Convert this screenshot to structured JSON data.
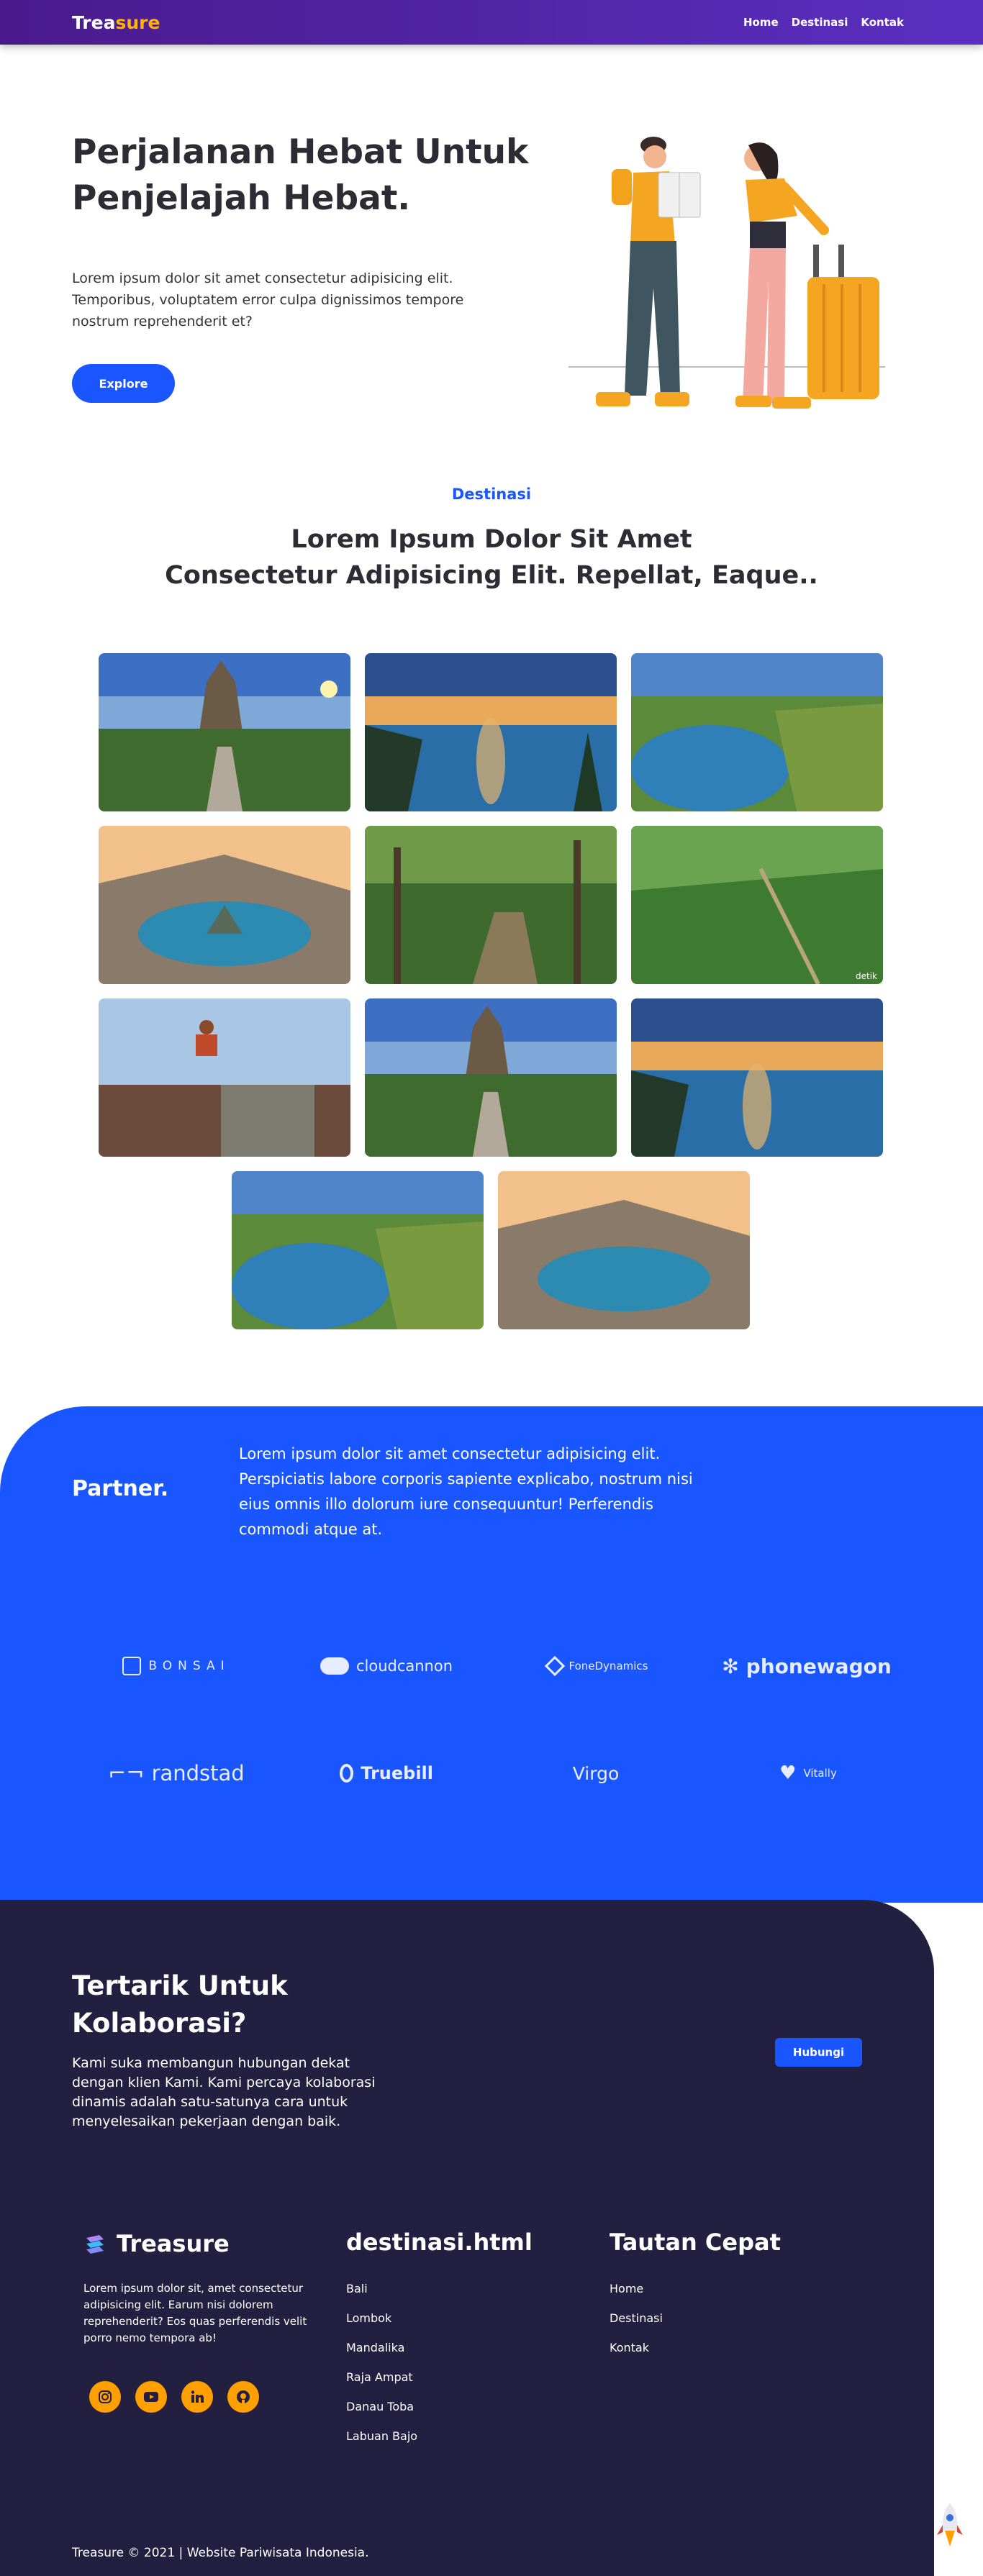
{
  "nav": {
    "brand_part1": "Trea",
    "brand_part2": "sure",
    "links": [
      "Home",
      "Destinasi",
      "Kontak"
    ]
  },
  "hero": {
    "title": "Perjalanan Hebat Untuk Penjelajah Hebat.",
    "text": "Lorem ipsum dolor sit amet consectetur adipisicing elit. Temporibus, voluptatem error culpa dignissimos tempore nostrum reprehenderit et?",
    "button": "Explore"
  },
  "destinasi": {
    "kicker": "Destinasi",
    "title_line1": "Lorem Ipsum Dolor Sit Amet",
    "title_line2": "Consectetur Adipisicing Elit. Repellat, Eaque.."
  },
  "gallery": {
    "count": 11,
    "images": [
      "temple",
      "lake-sunset",
      "island-bay",
      "crater-lake",
      "forest-bridge",
      "green-hills",
      "stone-jumper",
      "temple",
      "lake-sunset",
      "island-bay",
      "crater-lake"
    ],
    "watermark": "detik"
  },
  "partner": {
    "title": "Partner.",
    "text": "Lorem ipsum dolor sit amet consectetur adipisicing elit. Perspiciatis labore corporis sapiente explicabo, nostrum nisi eius omnis illo dolorum iure consequuntur! Perferendis commodi atque at.",
    "logos": [
      "BONSAI",
      "cloudcannon",
      "FoneDynamics",
      "phonewagon",
      "randstad",
      "Truebill",
      "Virgo",
      "Vitally"
    ]
  },
  "collab": {
    "title": "Tertarik Untuk Kolaborasi?",
    "text": "Kami suka membangun hubungan dekat dengan klien Kami. Kami percaya kolaborasi dinamis adalah satu-satunya cara untuk menyelesaikan pekerjaan dengan baik.",
    "button": "Hubungi"
  },
  "footer": {
    "brand": "Treasure",
    "about": "Lorem ipsum dolor sit, amet consectetur adipisicing elit. Earum nisi dolorem reprehenderit? Eos quas perferendis velit porro nemo tempora ab!",
    "socials": [
      "instagram-icon",
      "youtube-icon",
      "linkedin-icon",
      "github-icon"
    ],
    "col2_title": "destinasi.html",
    "col2_links": [
      "Bali",
      "Lombok",
      "Mandalika",
      "Raja Ampat",
      "Danau Toba",
      "Labuan Bajo"
    ],
    "col3_title": "Tautan Cepat",
    "col3_links": [
      "Home",
      "Destinasi",
      "Kontak"
    ],
    "copyright": "Treasure © 2021 | Website Pariwisata Indonesia."
  },
  "colors": {
    "accent": "#1a56ff",
    "nav": "#4a1a8c",
    "brand_yellow": "#ffb300",
    "footer": "#221f40",
    "social": "#ff9f00"
  }
}
